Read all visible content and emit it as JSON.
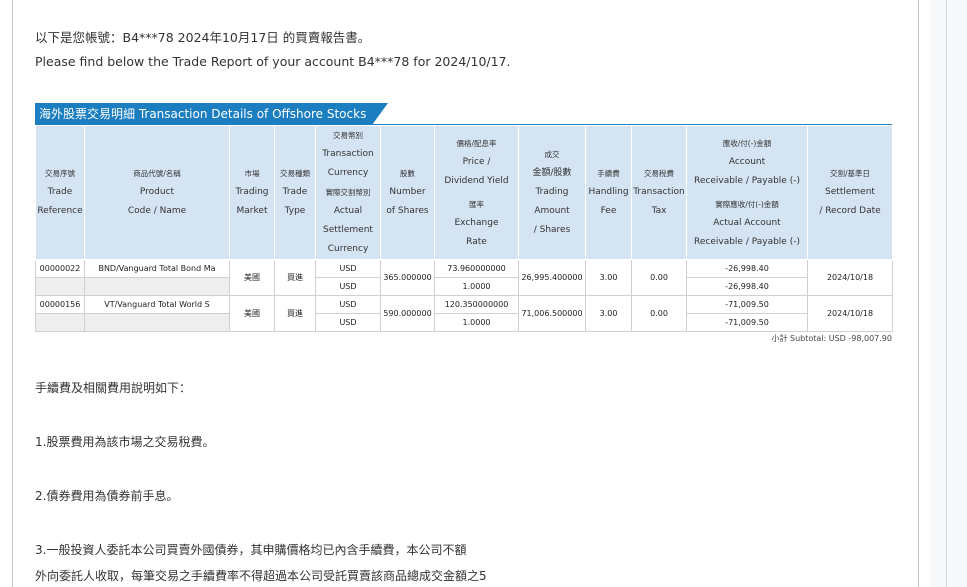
{
  "intro": {
    "zh": "以下是您帳號：B4***78 2024年10月17日 的買賣報告書。",
    "en": "Please find below the Trade Report of your account B4***78 for 2024/10/17."
  },
  "section_title": "海外股票交易明細 Transaction Details of Offshore Stocks",
  "headers": {
    "trade_ref": {
      "zh": "交易序號",
      "en": [
        "Trade",
        "Reference"
      ]
    },
    "product": {
      "zh": "商品代號/名稱",
      "en": [
        "Product",
        "Code / Name"
      ]
    },
    "market": {
      "zh": "市場",
      "en": [
        "Trading",
        "Market"
      ]
    },
    "trade_type": {
      "zh": "交易種類",
      "en": [
        "Trade",
        "Type"
      ]
    },
    "currency": {
      "zh": "交易幣別",
      "en": [
        "Transaction",
        "Currency"
      ],
      "zh2": "實際交割幣別",
      "en2": [
        "Actual",
        "Settlement",
        "Currency"
      ]
    },
    "shares": {
      "zh": "股數",
      "en": [
        "Number",
        "of Shares"
      ]
    },
    "price": {
      "zh": "價格/配息率",
      "en": [
        "Price /",
        "Dividend Yield"
      ],
      "zh2": "匯率",
      "en2": [
        "Exchange",
        "Rate"
      ]
    },
    "amount": {
      "zh": "成交",
      "zh_b": "金額/股數",
      "en": [
        "Trading",
        "Amount",
        "/ Shares"
      ]
    },
    "fee": {
      "zh": "手續費",
      "en": [
        "Handling",
        "Fee"
      ]
    },
    "tax": {
      "zh": "交易稅費",
      "en": [
        "Transaction",
        "Tax"
      ]
    },
    "receivable": {
      "zh": "應收/付(-)金額",
      "en": [
        "Account",
        "Receivable / Payable (-)"
      ],
      "zh2": "實際應收/付(-)金額",
      "en2": [
        "Actual Account",
        "Receivable / Payable (-)"
      ]
    },
    "settlement": {
      "zh": "交割/基準日",
      "en": [
        "Settlement",
        "/ Record Date"
      ]
    }
  },
  "rows": [
    {
      "ref": "00000022",
      "product": "BND/Vanguard Total Bond Ma",
      "market": "美國",
      "type": "買進",
      "currency": "USD",
      "settle_currency": "USD",
      "shares": "365.000000",
      "price": "73.960000000",
      "fx": "1.0000",
      "amount": "26,995.400000",
      "fee": "3.00",
      "tax": "0.00",
      "receivable": "-26,998.40",
      "actual_receivable": "-26,998.40",
      "date": "2024/10/18"
    },
    {
      "ref": "00000156",
      "product": "VT/Vanguard Total World S",
      "market": "美國",
      "type": "買進",
      "currency": "USD",
      "settle_currency": "USD",
      "shares": "590.000000",
      "price": "120.350000000",
      "fx": "1.0000",
      "amount": "71,006.500000",
      "fee": "3.00",
      "tax": "0.00",
      "receivable": "-71,009.50",
      "actual_receivable": "-71,009.50",
      "date": "2024/10/18"
    }
  ],
  "subtotal": "小計 Subtotal: USD -98,007.90",
  "notes": {
    "heading": "手續費及相關費用說明如下：",
    "n1": "1.股票費用為該市場之交易稅費。",
    "n2": "2.債券費用為債券前手息。",
    "n3a": "3.一般投資人委託本公司買賣外國債券，其申購價格均已內含手續費，本公司不額",
    "n3b": "外向委託人收取，每筆交易之手續費率不得超過本公司受託買賣該商品總成交金額之5"
  },
  "colors": {
    "accent": "#1a7ec0",
    "header_bg": "#d5e4f3"
  }
}
